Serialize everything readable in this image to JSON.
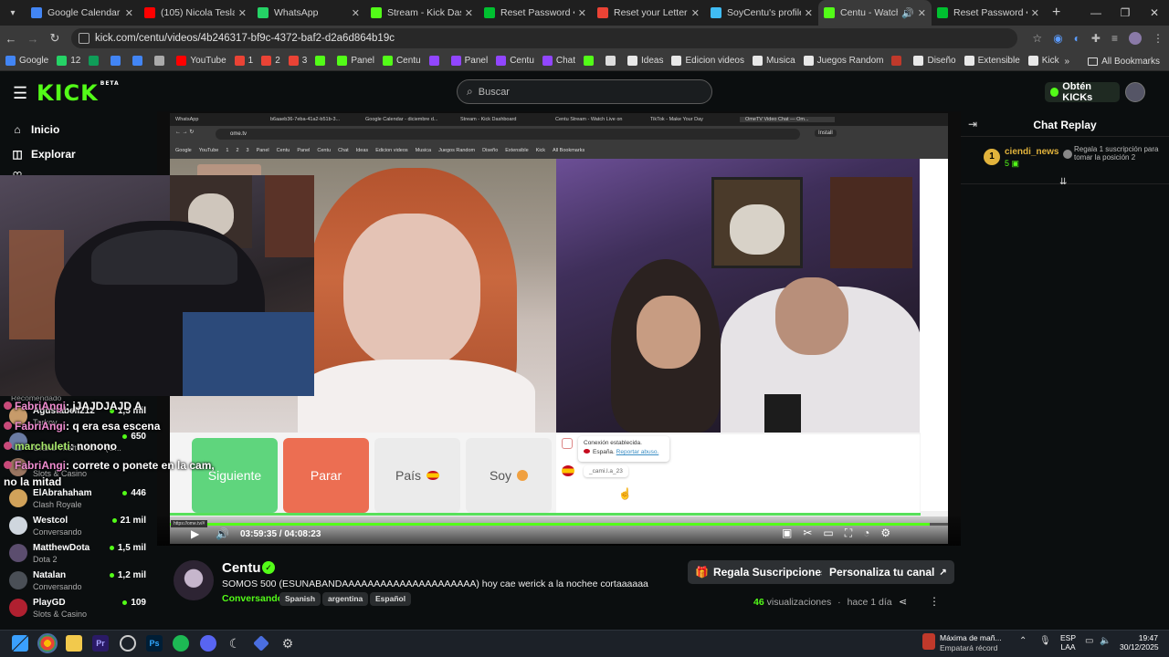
{
  "browser": {
    "tabs": [
      {
        "title": "Google Calendar - di",
        "color": "#4285f4",
        "active": false
      },
      {
        "title": "(105) Nicola Tesla's 3",
        "color": "#ff0000",
        "active": false
      },
      {
        "title": "WhatsApp",
        "color": "#25d366",
        "active": false
      },
      {
        "title": "Stream - Kick Dashb",
        "color": "#53fc18",
        "active": false
      },
      {
        "title": "Reset Password • Let",
        "color": "#00c030",
        "active": false
      },
      {
        "title": "Reset your Letterbox",
        "color": "#ea4335",
        "active": false
      },
      {
        "title": "SoyCentu's profile • L",
        "color": "#40bcf4",
        "active": false
      },
      {
        "title": "Centu - Watch th",
        "color": "#53fc18",
        "active": true
      },
      {
        "title": "Reset Password • Let",
        "color": "#00c030",
        "active": false
      }
    ],
    "new_tab": "+",
    "url": "kick.com/centu/videos/4b246317-bf9c-4372-baf2-d2a6d864b19c",
    "bookmarks": [
      {
        "label": "Google",
        "color": "#4285f4"
      },
      {
        "label": "12",
        "color": "#25d366"
      },
      {
        "label": "",
        "color": "#0f9d58"
      },
      {
        "label": "",
        "color": "#4285f4"
      },
      {
        "label": "",
        "color": "#4285f4"
      },
      {
        "label": "",
        "color": "#aaaaaa"
      },
      {
        "label": "YouTube",
        "color": "#ff0000"
      },
      {
        "label": "1",
        "color": "#ea4335"
      },
      {
        "label": "2",
        "color": "#ea4335"
      },
      {
        "label": "3",
        "color": "#ea4335"
      },
      {
        "label": "",
        "color": "#53fc18"
      },
      {
        "label": "Panel",
        "color": "#53fc18"
      },
      {
        "label": "Centu",
        "color": "#53fc18"
      },
      {
        "label": "",
        "color": "#9146ff"
      },
      {
        "label": "Panel",
        "color": "#9146ff"
      },
      {
        "label": "Centu",
        "color": "#9146ff"
      },
      {
        "label": "Chat",
        "color": "#9146ff"
      },
      {
        "label": "",
        "color": "#53fc18"
      },
      {
        "label": "",
        "color": "#dddddd"
      },
      {
        "label": "Ideas",
        "color": "#e8e8e8"
      },
      {
        "label": "Edicion videos",
        "color": "#e8e8e8"
      },
      {
        "label": "Musica",
        "color": "#e8e8e8"
      },
      {
        "label": "Juegos Random",
        "color": "#e8e8e8"
      },
      {
        "label": "",
        "color": "#c0392b"
      },
      {
        "label": "Diseño",
        "color": "#e8e8e8"
      },
      {
        "label": "Extensible",
        "color": "#e8e8e8"
      },
      {
        "label": "Kick",
        "color": "#e8e8e8"
      }
    ],
    "bookmarks_overflow": "»",
    "all_bookmarks": "All Bookmarks"
  },
  "kick": {
    "logo": "KICK",
    "logo_badge": "BETA",
    "search_placeholder": "Buscar",
    "get_kicks": "Obtén KICKs",
    "sidebar": {
      "home": "Inicio",
      "explore": "Explorar",
      "recommended": "Recomendado"
    },
    "recommended": [
      {
        "name": "Agustabell212",
        "sub": "Tarkov",
        "viewers": "1,5 mil",
        "color": "#c79b6a"
      },
      {
        "name": "",
        "sub": "Grand Theft Auto V (G...",
        "viewers": "650",
        "color": "#6a7ba3"
      },
      {
        "name": "",
        "sub": "Slots & Casino",
        "viewers": "",
        "color": "#9a7560"
      },
      {
        "name": "ElAbrahaham",
        "sub": "Clash Royale",
        "viewers": "446",
        "color": "#d1a25a"
      },
      {
        "name": "Westcol",
        "sub": "Conversando",
        "viewers": "21 mil",
        "color": "#cfd6de"
      },
      {
        "name": "MatthewDota",
        "sub": "Dota 2",
        "viewers": "1,5 mil",
        "color": "#5b4d6e"
      },
      {
        "name": "Natalan",
        "sub": "Conversando",
        "viewers": "1,2 mil",
        "color": "#4a4f56"
      },
      {
        "name": "PlayGD",
        "sub": "Slots & Casino",
        "viewers": "109",
        "color": "#b02030"
      }
    ],
    "chat_overlay": [
      {
        "user": "FabriAngi",
        "text": ": jJAJDJAJD A"
      },
      {
        "user": "FabriAngi",
        "text": ": q era esa escena"
      },
      {
        "user": "marchuleti",
        "text": ": nonono"
      },
      {
        "user": "FabriAngi",
        "text": ": correte o ponete en la cam,"
      },
      {
        "user": "",
        "text": "no la mitad"
      }
    ],
    "chat_replay": {
      "title": "Chat Replay",
      "gift_user": "ciendi_news",
      "gift_rank": "1",
      "gift_count": "5",
      "gift_text": "Regala 1 suscripción para tomar la posición 2"
    },
    "player": {
      "time": "03:59:35 / 04:08:23",
      "progress": 0.976
    },
    "stream": {
      "name": "Centu",
      "title": "SOMOS 500 (ESUNABANDAAAAAAAAAAAAAAAAAAAAA) hoy cae werick a la nochee cortaaaaaa",
      "category": "Conversando",
      "tags": [
        "Spanish",
        "argentina",
        "Español"
      ],
      "gift_subs": "Regala Suscripciones",
      "customize": "Personaliza tu canal",
      "views_count": "46",
      "views_label": "visualizaciones",
      "ago": "hace 1 día"
    }
  },
  "inner_video": {
    "tabs": [
      "WhatsApp",
      "b6aaeb36-7eba-41a2-b51b-3...",
      "Google Calendar - diciembre d...",
      "Stream - Kick Dashboard",
      "Centu Stream - Watch Live on",
      "TikTok - Make Your Day",
      "OmeTV Video Chat — Om..."
    ],
    "url": "ome.tv",
    "install": "Install",
    "bookmarks": [
      "Google",
      "YouTube",
      "1",
      "2",
      "3",
      "Panel",
      "Centu",
      "Panel",
      "Centu",
      "Chat",
      "Ideas",
      "Edicion videos",
      "Musica",
      "Juegos Random",
      "Diseño",
      "Extensible",
      "Kick",
      "All Bookmarks"
    ],
    "buttons": {
      "next": "Siguiente",
      "stop": "Parar",
      "country": "País",
      "gender": "Soy"
    },
    "chat": {
      "connected": "Conexión establecida.",
      "country": "España.",
      "report": "Reportar abuso.",
      "user": "_cami.l.a_23"
    },
    "status_link": "https://ome.tv/#"
  },
  "taskbar": {
    "weather_title": "Máxima de mañ...",
    "weather_sub": "Empatará récord",
    "lang": "ESP",
    "lang2": "LAA",
    "time": "19:47",
    "date": "30/12/2025"
  }
}
